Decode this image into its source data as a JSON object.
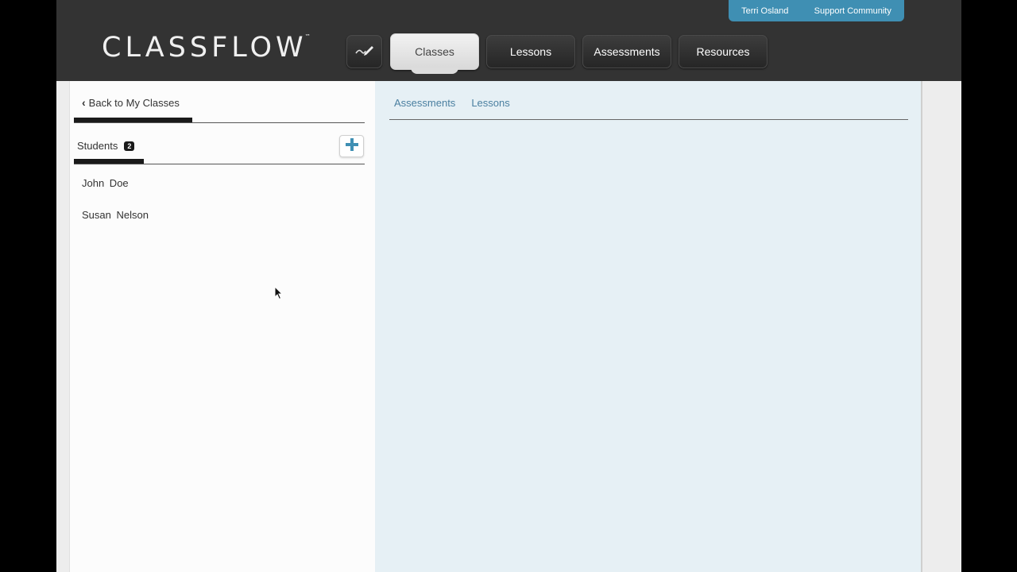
{
  "header": {
    "logo": "CLASSFLOW",
    "logo_tm": "™",
    "user_links": [
      "Terri Osland",
      "Support Community"
    ],
    "nav": [
      {
        "label": "Classes",
        "active": true
      },
      {
        "label": "Lessons",
        "active": false
      },
      {
        "label": "Assessments",
        "active": false
      },
      {
        "label": "Resources",
        "active": false
      }
    ],
    "pen_icon": "pen-icon"
  },
  "left": {
    "back_label": "Back to My Classes",
    "students_label": "Students",
    "students_count": "2",
    "students": [
      "John  Doe",
      "Susan  Nelson"
    ]
  },
  "right": {
    "tabs": [
      "Assessments",
      "Lessons"
    ]
  },
  "colors": {
    "accent": "#3f8fb3",
    "topbar": "#333333",
    "panel_bg": "#e6f0f5"
  }
}
